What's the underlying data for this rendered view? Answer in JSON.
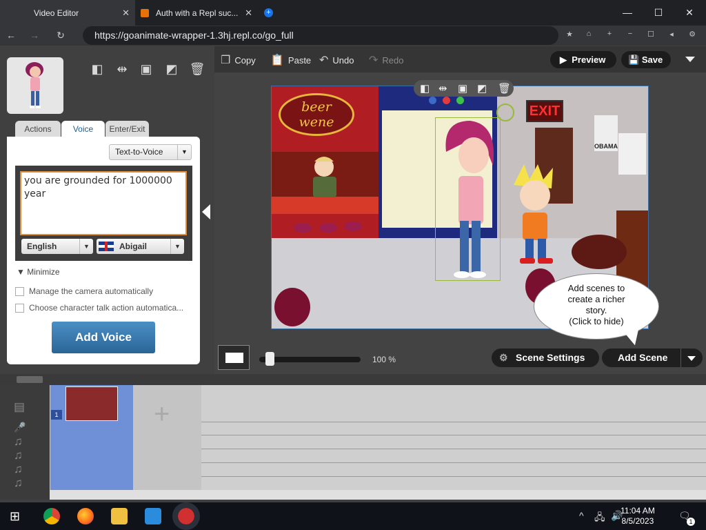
{
  "browser": {
    "tabs": [
      {
        "title": "Video Editor",
        "active": true
      },
      {
        "title": "Auth with a Repl suc..."
      }
    ],
    "url": "https://goanimate-wrapper-1.3hj.repl.co/go_full"
  },
  "toolbar": {
    "copy": "Copy",
    "paste": "Paste",
    "undo": "Undo",
    "redo": "Redo",
    "preview": "Preview",
    "save": "Save"
  },
  "left_panel": {
    "tabs": [
      "Actions",
      "Voice",
      "Enter/Exit"
    ],
    "active_tab": "Voice",
    "voice_mode": "Text-to-Voice",
    "voice_text": "you are grounded for 1000000 year",
    "language": "English",
    "voice": "Abigail",
    "minimize_label": "Minimize",
    "options": [
      {
        "label": "Manage the camera automatically",
        "checked": false
      },
      {
        "label": "Choose character talk action automatica...",
        "checked": false
      }
    ],
    "add_voice_label": "Add Voice"
  },
  "stage": {
    "bubble_text": [
      "Add scenes to",
      "create a richer",
      "story.",
      "(Click to hide)"
    ],
    "sign_exit": "EXIT",
    "sign_beer": [
      "beer",
      "wene"
    ],
    "poster": "OBAMA"
  },
  "controls": {
    "zoom": "100 %",
    "zoom_fraction": 0.1,
    "scene_settings": "Scene Settings",
    "add_scene": "Add Scene"
  },
  "timeline": {
    "scene_number": "1"
  },
  "taskbar": {
    "time": "11:04 AM",
    "date": "8/5/2023",
    "notifications": "1"
  },
  "colors": {
    "accent_blue": "#2b6597",
    "text_border_orange": "#e38d3a",
    "selection_green": "#9ab83c"
  }
}
